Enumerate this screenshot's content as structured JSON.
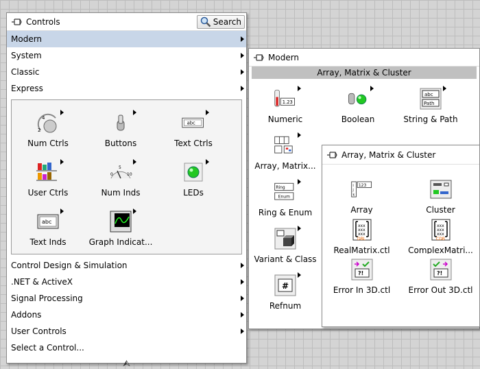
{
  "controls_palette": {
    "title": "Controls",
    "search_label": "Search",
    "categories_top": [
      {
        "label": "Modern",
        "has_submenu": true,
        "active": true
      },
      {
        "label": "System",
        "has_submenu": true
      },
      {
        "label": "Classic",
        "has_submenu": true
      },
      {
        "label": "Express",
        "has_submenu": true
      }
    ],
    "express_tiles": [
      {
        "label": "Num Ctrls",
        "icon": "numeric-knob-icon"
      },
      {
        "label": "Buttons",
        "icon": "toggle-switch-icon"
      },
      {
        "label": "Text Ctrls",
        "icon": "text-control-icon"
      },
      {
        "label": "User Ctrls",
        "icon": "user-controls-icon"
      },
      {
        "label": "Num Inds",
        "icon": "meter-icon"
      },
      {
        "label": "LEDs",
        "icon": "led-icon"
      },
      {
        "label": "Text Inds",
        "icon": "text-indicator-icon"
      },
      {
        "label": "Graph Indicat...",
        "icon": "graph-icon"
      }
    ],
    "categories_bottom": [
      {
        "label": "Control Design & Simulation",
        "has_submenu": true
      },
      {
        "label": ".NET & ActiveX",
        "has_submenu": true
      },
      {
        "label": "Signal Processing",
        "has_submenu": true
      },
      {
        "label": "Addons",
        "has_submenu": true
      },
      {
        "label": "User Controls",
        "has_submenu": true
      },
      {
        "label": "Select a Control...",
        "has_submenu": false
      }
    ],
    "collapse_glyph": "⮙"
  },
  "modern_palette": {
    "title": "Modern",
    "section_header": "Array, Matrix & Cluster",
    "tiles": [
      {
        "label": "Numeric",
        "icon": "numeric-icon"
      },
      {
        "label": "Boolean",
        "icon": "boolean-icon"
      },
      {
        "label": "String & Path",
        "icon": "string-path-icon"
      },
      {
        "label": "Array, Matrix...",
        "icon": "array-matrix-icon"
      },
      {
        "label": "Ring & Enum",
        "icon": "ring-enum-icon"
      },
      {
        "label": "Variant & Class",
        "icon": "variant-class-icon"
      },
      {
        "label": "Refnum",
        "icon": "refnum-icon"
      }
    ],
    "ring_text": "Ring",
    "enum_text": "Enum",
    "numeric_text": "1.23",
    "string_text": "abc",
    "path_text": "Path",
    "refnum_text": "#"
  },
  "array_palette": {
    "title": "Array, Matrix & Cluster",
    "tiles": [
      {
        "label": "Array",
        "icon": "array-icon"
      },
      {
        "label": "Cluster",
        "icon": "cluster-icon"
      },
      {
        "label": "RealMatrix.ctl",
        "icon": "real-matrix-icon"
      },
      {
        "label": "ComplexMatri...",
        "icon": "complex-matrix-icon"
      },
      {
        "label": "Error In 3D.ctl",
        "icon": "error-in-icon"
      },
      {
        "label": "Error Out 3D.ctl",
        "icon": "error-out-icon"
      }
    ],
    "array_num_text": "123",
    "dbl_text": "DBL",
    "cdb_text": "CDB",
    "err_text": "?!"
  },
  "colors": {
    "active_row": "#c8d6e8",
    "led_green": "#22c822",
    "canvas_grid": "#bdbdbd"
  }
}
